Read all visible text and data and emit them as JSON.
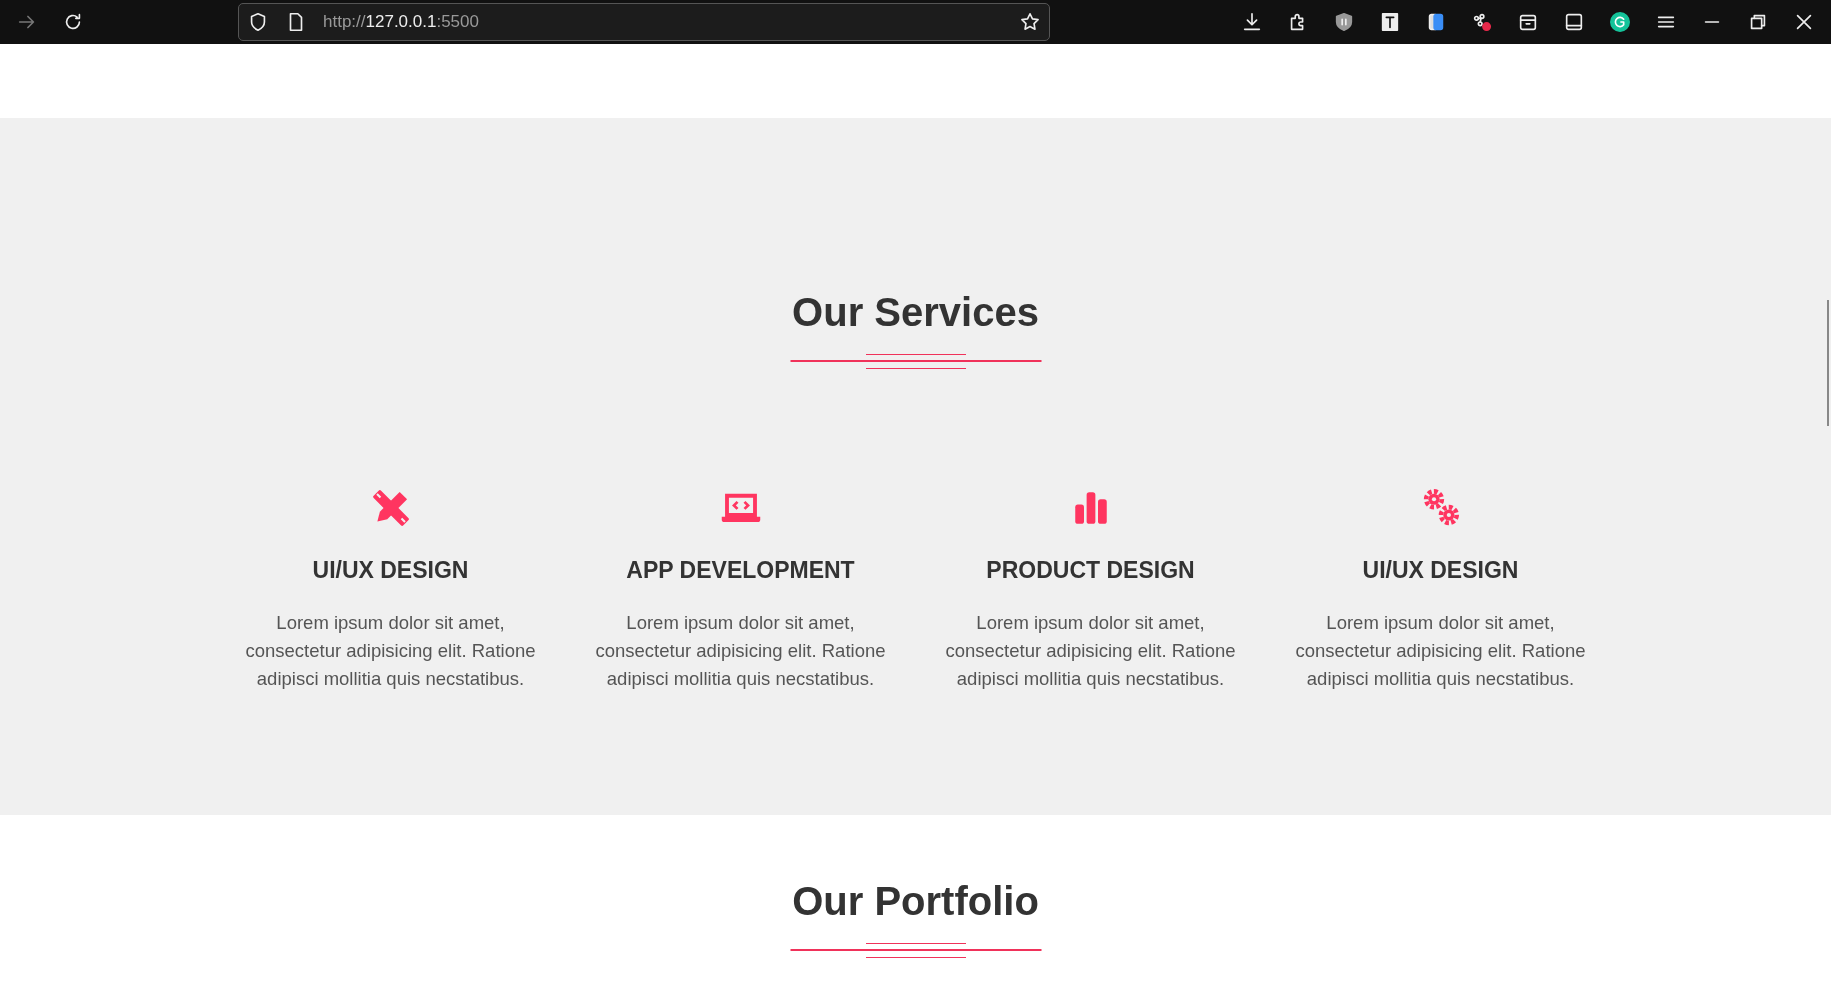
{
  "browser": {
    "url_prefix": "http://",
    "url_host": "127.0.0.1",
    "url_port": ":5500"
  },
  "services": {
    "title": "Our Services",
    "items": [
      {
        "title": "UI/UX DESIGN",
        "text": "Lorem ipsum dolor sit amet, consectetur adipisicing elit. Ratione adipisci mollitia quis necstatibus."
      },
      {
        "title": "APP DEVELOPMENT",
        "text": "Lorem ipsum dolor sit amet, consectetur adipisicing elit. Ratione adipisci mollitia quis necstatibus."
      },
      {
        "title": "PRODUCT DESIGN",
        "text": "Lorem ipsum dolor sit amet, consectetur adipisicing elit. Ratione adipisci mollitia quis necstatibus."
      },
      {
        "title": "UI/UX DESIGN",
        "text": "Lorem ipsum dolor sit amet, consectetur adipisicing elit. Ratione adipisci mollitia quis necstatibus."
      }
    ]
  },
  "portfolio": {
    "title": "Our Portfolio"
  }
}
